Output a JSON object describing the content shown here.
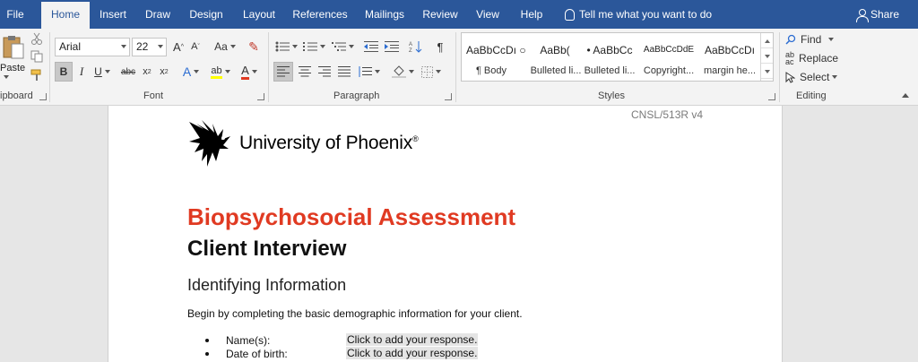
{
  "tabs": [
    "File",
    "Home",
    "Insert",
    "Draw",
    "Design",
    "Layout",
    "References",
    "Mailings",
    "Review",
    "View",
    "Help"
  ],
  "active_tab": "Home",
  "tell_me": "Tell me what you want to do",
  "share": "Share",
  "clipboard": {
    "paste": "Paste",
    "label": "ipboard"
  },
  "font": {
    "name": "Arial",
    "size": "22",
    "label": "Font",
    "grow": "A",
    "shrink": "A",
    "case": "Aa"
  },
  "paragraph": {
    "label": "Paragraph"
  },
  "styles": {
    "label": "Styles",
    "items": [
      {
        "preview": "AaBbCcDı",
        "name": "¶ Body"
      },
      {
        "preview": "○",
        "name": ""
      },
      {
        "preview": "AaBb(",
        "name": "Bulleted li..."
      },
      {
        "preview": "• AaBbCc",
        "name": "Bulleted li..."
      },
      {
        "preview": "AaBbCcDdE",
        "name": "Copyright..."
      },
      {
        "preview": "AaBbCcDı",
        "name": "margin he..."
      }
    ]
  },
  "editing": {
    "label": "Editing",
    "find": "Find",
    "replace": "Replace",
    "select": "Select"
  },
  "document": {
    "doc_id": "CNSL/513R v4",
    "logo_text": "University of Phoenix",
    "title": "Biopsychosocial Assessment",
    "subtitle": "Client Interview",
    "section": "Identifying Information",
    "intro": "Begin by completing the basic demographic information for your client.",
    "fields": [
      {
        "label": "Name(s):",
        "response": "Click to add your response."
      },
      {
        "label": "Date of birth:",
        "response": "Click to add your response."
      }
    ]
  },
  "colors": {
    "ribbon_blue": "#2b579a",
    "title_red": "#e03a22"
  }
}
